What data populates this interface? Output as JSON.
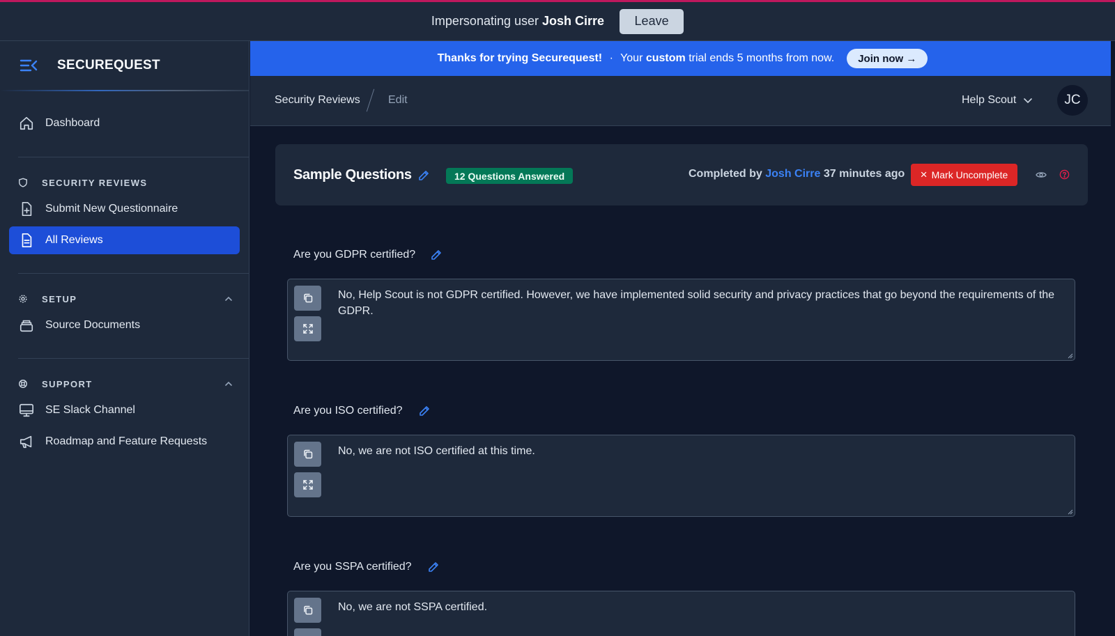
{
  "impersonation": {
    "prefix": "Impersonating user",
    "user": "Josh Cirre",
    "leave_label": "Leave"
  },
  "brand": {
    "name": "SECUREQUEST",
    "icon": "menu-collapse-icon"
  },
  "sidebar": {
    "dashboard": {
      "label": "Dashboard",
      "icon": "home-icon"
    },
    "sections": [
      {
        "title": "SECURITY REVIEWS",
        "icon": "shield-icon",
        "items": [
          {
            "label": "Submit New Questionnaire",
            "icon": "file-plus-icon"
          },
          {
            "label": "All Reviews",
            "icon": "file-text-icon",
            "active": true
          }
        ]
      },
      {
        "title": "SETUP",
        "icon": "cog-icon",
        "collapsible": true,
        "items": [
          {
            "label": "Source Documents",
            "icon": "stack-icon"
          }
        ]
      },
      {
        "title": "SUPPORT",
        "icon": "lifebuoy-icon",
        "collapsible": true,
        "items": [
          {
            "label": "SE Slack Channel",
            "icon": "monitor-icon"
          },
          {
            "label": "Roadmap and Feature Requests",
            "icon": "megaphone-icon"
          }
        ]
      }
    ]
  },
  "trial": {
    "thanks": "Thanks for trying Securequest!",
    "sep": "·",
    "your": "Your",
    "plan": "custom",
    "ends": "trial ends 5 months from now.",
    "join_label": "Join now →"
  },
  "header": {
    "breadcrumb": [
      "Security Reviews",
      "Edit"
    ],
    "org": "Help Scout",
    "avatar_initials": "JC"
  },
  "review": {
    "title": "Sample Questions",
    "badge": "12 Questions Answered",
    "completed_prefix": "Completed by",
    "completed_by": "Josh Cirre",
    "completed_when": "37 minutes ago",
    "uncomplete_label": "Mark Uncomplete",
    "uncomplete_icon": "×"
  },
  "questions": [
    {
      "question": "Are you GDPR certified?",
      "answer": "No, Help Scout is not GDPR certified. However, we have implemented solid security and privacy practices that go beyond the requirements of the GDPR."
    },
    {
      "question": "Are you ISO certified?",
      "answer": "No, we are not ISO certified at this time."
    },
    {
      "question": "Are you SSPA certified?",
      "answer": "No, we are not SSPA certified."
    }
  ],
  "colors": {
    "accent": "#2563eb",
    "active_nav": "#1d4ed8",
    "success_badge": "#047857",
    "danger": "#dc2626",
    "background": "#0f172a",
    "panel": "#1e293b"
  }
}
